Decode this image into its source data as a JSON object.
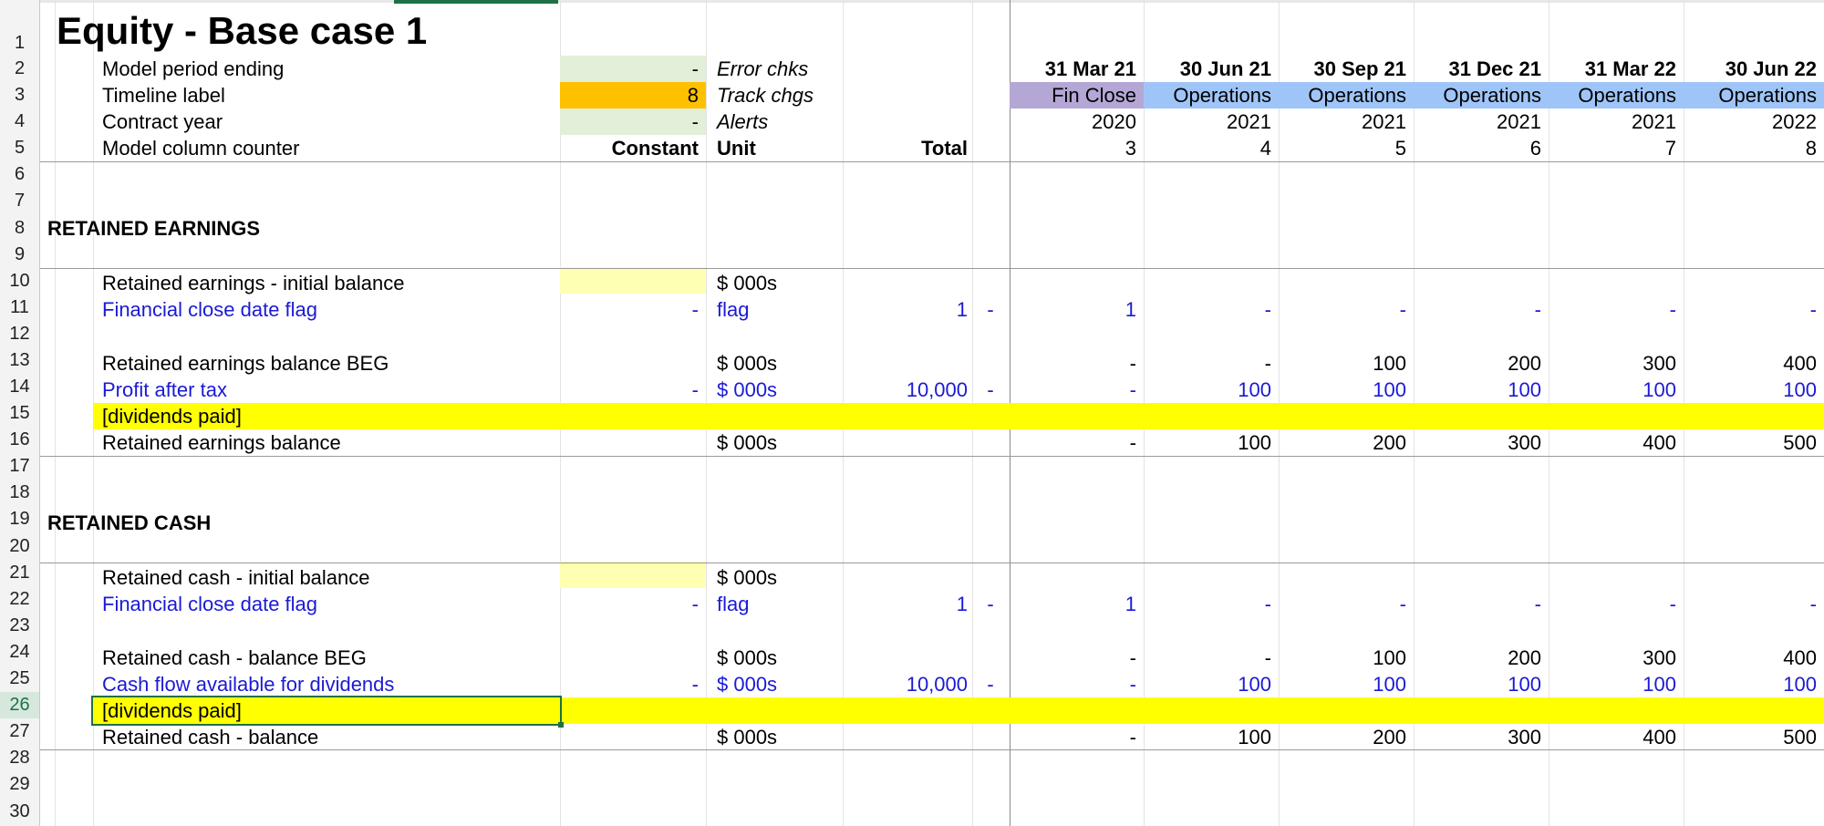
{
  "sheet": {
    "title": "Equity - Base case 1",
    "row_numbers": [
      "1",
      "2",
      "3",
      "4",
      "5",
      "6",
      "7",
      "8",
      "9",
      "10",
      "11",
      "12",
      "13",
      "14",
      "15",
      "16",
      "17",
      "18",
      "19",
      "20",
      "21",
      "22",
      "23",
      "24",
      "25",
      "26",
      "27",
      "28",
      "29",
      "30"
    ],
    "header_rows": {
      "model_period_ending": {
        "label": "Model period ending",
        "value": "-",
        "unit": "Error chks"
      },
      "timeline_label": {
        "label": "Timeline label",
        "value": "8",
        "unit": "Track chgs"
      },
      "contract_year": {
        "label": "Contract year",
        "value": "-",
        "unit": "Alerts"
      },
      "column_counter": {
        "label": "Model column counter",
        "constant": "Constant",
        "unit": "Unit",
        "total": "Total"
      }
    },
    "periods": {
      "dates": [
        "31 Mar 21",
        "30 Jun 21",
        "30 Sep 21",
        "31 Dec 21",
        "31 Mar 22",
        "30 Jun 22"
      ],
      "timeline": [
        "Fin Close",
        "Operations",
        "Operations",
        "Operations",
        "Operations",
        "Operations"
      ],
      "years": [
        "2020",
        "2021",
        "2021",
        "2021",
        "2021",
        "2022"
      ],
      "counters": [
        "3",
        "4",
        "5",
        "6",
        "7",
        "8"
      ]
    },
    "sections": {
      "retained_earnings": {
        "heading": "RETAINED EARNINGS",
        "initial_balance": {
          "label": "Retained earnings - initial balance",
          "unit": "$ 000s"
        },
        "flag": {
          "label": "Financial close date flag",
          "constant": "-",
          "unit": "flag",
          "total": "1",
          "dash": "-",
          "values": [
            "1",
            "-",
            "-",
            "-",
            "-",
            "-"
          ]
        },
        "balance_beg": {
          "label": "Retained earnings balance BEG",
          "unit": "$ 000s",
          "values": [
            "-",
            "-",
            "100",
            "200",
            "300",
            "400"
          ]
        },
        "flow": {
          "label": "Profit after tax",
          "constant": "-",
          "unit": "$ 000s",
          "total": "10,000",
          "dash": "-",
          "values": [
            "-",
            "100",
            "100",
            "100",
            "100",
            "100"
          ]
        },
        "dividends": {
          "label": "[dividends paid]"
        },
        "balance": {
          "label": "Retained earnings balance",
          "unit": "$ 000s",
          "values": [
            "-",
            "100",
            "200",
            "300",
            "400",
            "500"
          ]
        }
      },
      "retained_cash": {
        "heading": "RETAINED CASH",
        "initial_balance": {
          "label": "Retained cash - initial balance",
          "unit": "$ 000s"
        },
        "flag": {
          "label": "Financial close date flag",
          "constant": "-",
          "unit": "flag",
          "total": "1",
          "dash": "-",
          "values": [
            "1",
            "-",
            "-",
            "-",
            "-",
            "-"
          ]
        },
        "balance_beg": {
          "label": "Retained cash - balance BEG",
          "unit": "$ 000s",
          "values": [
            "-",
            "-",
            "100",
            "200",
            "300",
            "400"
          ]
        },
        "flow": {
          "label": "Cash flow available for dividends",
          "constant": "-",
          "unit": "$ 000s",
          "total": "10,000",
          "dash": "-",
          "values": [
            "-",
            "100",
            "100",
            "100",
            "100",
            "100"
          ]
        },
        "dividends": {
          "label": "[dividends paid]"
        },
        "balance": {
          "label": "Retained cash - balance",
          "unit": "$ 000s",
          "values": [
            "-",
            "100",
            "200",
            "300",
            "400",
            "500"
          ]
        }
      }
    },
    "colors": {
      "input_green": "#e2efd9",
      "input_orange": "#ffc000",
      "input_yellow": "#ffffb3",
      "highlight_yellow": "#ffff00",
      "fin_close_purple": "#b4a7d6",
      "operations_blue": "#9fc5f8",
      "link_blue": "#1a1ad6",
      "selection_green": "#1e7145"
    },
    "selected_row": "26"
  }
}
